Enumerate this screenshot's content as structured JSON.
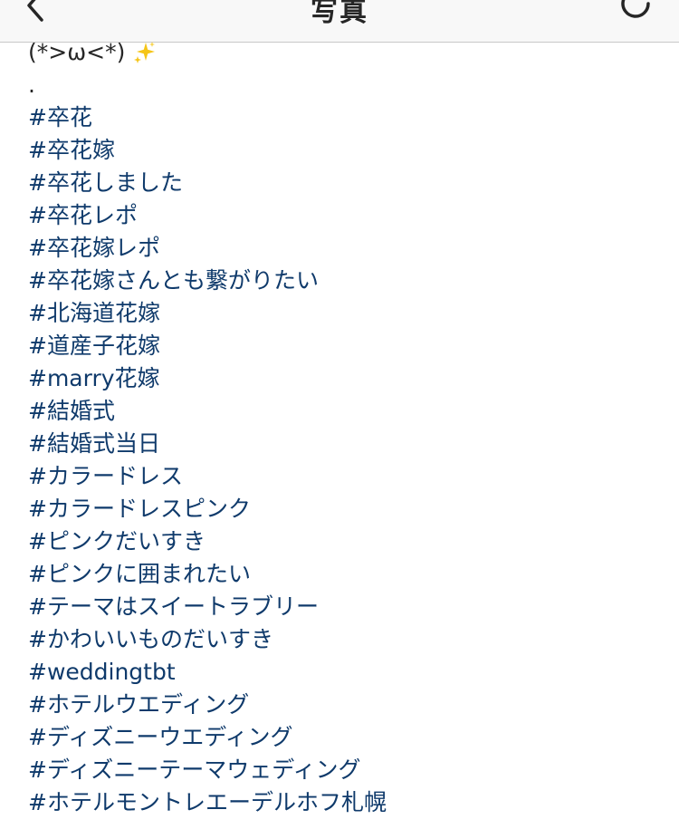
{
  "header": {
    "title": "写真",
    "back_icon": "chevron-left-icon",
    "refresh_icon": "refresh-icon"
  },
  "caption": {
    "emoticon": "(*>ω<*)",
    "sparkle_icon": "sparkles-emoji",
    "dot": ".",
    "hashtags": [
      "#卒花",
      "#卒花嫁",
      "#卒花しました",
      "#卒花レポ",
      "#卒花嫁レポ",
      "#卒花嫁さんとも繋がりたい",
      "#北海道花嫁",
      "#道産子花嫁",
      "#marry花嫁",
      "#結婚式",
      "#結婚式当日",
      "#カラードレス",
      "#カラードレスピンク",
      "#ピンクだいすき",
      "#ピンクに囲まれたい",
      "#テーマはスイートラブリー",
      "#かわいいものだいすき",
      "#weddingtbt",
      "#ホテルウエディング",
      "#ディズニーウエディング",
      "#ディズニーテーマウェディング",
      "#ホテルモントレエーデルホフ札幌"
    ]
  },
  "colors": {
    "hashtag": "#0f3a6b",
    "text": "#262626",
    "nav_background": "#f8f8f8"
  }
}
